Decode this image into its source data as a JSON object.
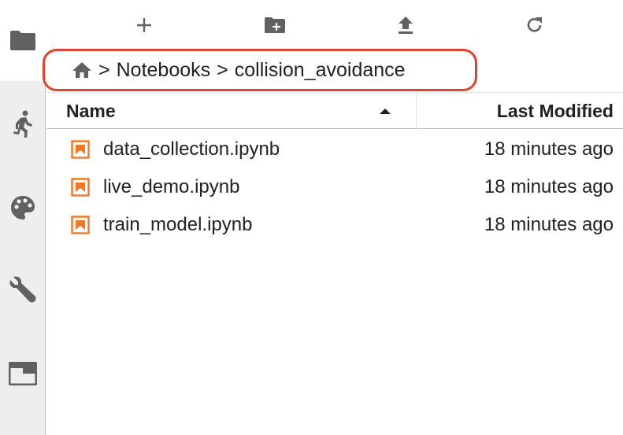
{
  "toolbar": {
    "new_launcher_icon": "plus-icon",
    "new_folder_icon": "new-folder-icon",
    "upload_icon": "upload-icon",
    "refresh_icon": "refresh-icon"
  },
  "sidebar": {
    "items": [
      {
        "icon": "folder-icon",
        "active": true
      },
      {
        "icon": "running-icon"
      },
      {
        "icon": "palette-icon"
      },
      {
        "icon": "wrench-icon"
      },
      {
        "icon": "tabs-icon"
      }
    ]
  },
  "breadcrumb": {
    "home_icon": "home-icon",
    "separator": ">",
    "items": [
      "Notebooks",
      "collision_avoidance"
    ],
    "highlight_color": "#e2412d"
  },
  "file_list": {
    "columns": {
      "name": "Name",
      "last_modified": "Last Modified"
    },
    "sort": "ascending",
    "files": [
      {
        "name": "data_collection.ipynb",
        "modified": "18 minutes ago"
      },
      {
        "name": "live_demo.ipynb",
        "modified": "18 minutes ago"
      },
      {
        "name": "train_model.ipynb",
        "modified": "18 minutes ago"
      }
    ],
    "notebook_icon_color": "#f37726"
  }
}
